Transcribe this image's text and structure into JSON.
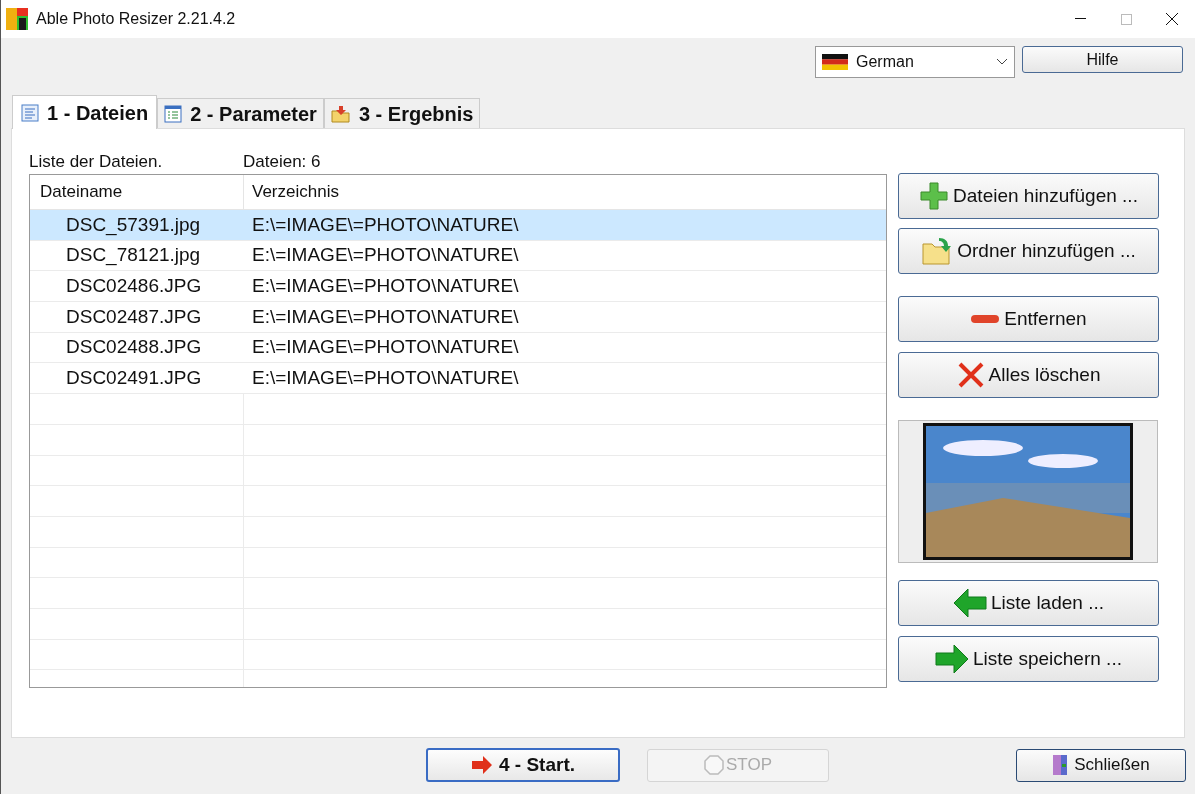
{
  "window": {
    "title": "Able Photo Resizer 2.21.4.2"
  },
  "language": {
    "value": "German"
  },
  "help_button": "Hilfe",
  "tabs": [
    {
      "label": "1 - Dateien",
      "selected": true,
      "kind": "list"
    },
    {
      "label": "2 - Parameter",
      "selected": false,
      "kind": "params"
    },
    {
      "label": "3 - Ergebnis",
      "selected": false,
      "kind": "result"
    }
  ],
  "list_label": "Liste der Dateien.",
  "file_count": "Dateien: 6",
  "table": {
    "columns": [
      "Dateiname",
      "Verzeichnis"
    ],
    "rows": [
      {
        "name": "DSC_57391.jpg",
        "dir": "E:\\=IMAGE\\=PHOTO\\NATURE\\",
        "selected": true
      },
      {
        "name": "DSC_78121.jpg",
        "dir": "E:\\=IMAGE\\=PHOTO\\NATURE\\",
        "selected": false
      },
      {
        "name": "DSC02486.JPG",
        "dir": "E:\\=IMAGE\\=PHOTO\\NATURE\\",
        "selected": false
      },
      {
        "name": "DSC02487.JPG",
        "dir": "E:\\=IMAGE\\=PHOTO\\NATURE\\",
        "selected": false
      },
      {
        "name": "DSC02488.JPG",
        "dir": "E:\\=IMAGE\\=PHOTO\\NATURE\\",
        "selected": false
      },
      {
        "name": "DSC02491.JPG",
        "dir": "E:\\=IMAGE\\=PHOTO\\NATURE\\",
        "selected": false
      }
    ]
  },
  "side_buttons": [
    {
      "label": "Dateien hinzufügen ...",
      "kind": "add"
    },
    {
      "label": "Ordner hinzufügen ...",
      "kind": "folder"
    },
    {
      "label": "Entfernen",
      "kind": "remove"
    },
    {
      "label": "Alles löschen",
      "kind": "clear"
    },
    {
      "label": "Liste laden ...",
      "kind": "load"
    },
    {
      "label": "Liste speichern ...",
      "kind": "save"
    }
  ],
  "start_button": {
    "label": "4 - Start.",
    "disabled": false
  },
  "stop_button": {
    "label": "STOP",
    "disabled": true
  },
  "close_button": "Schließen"
}
